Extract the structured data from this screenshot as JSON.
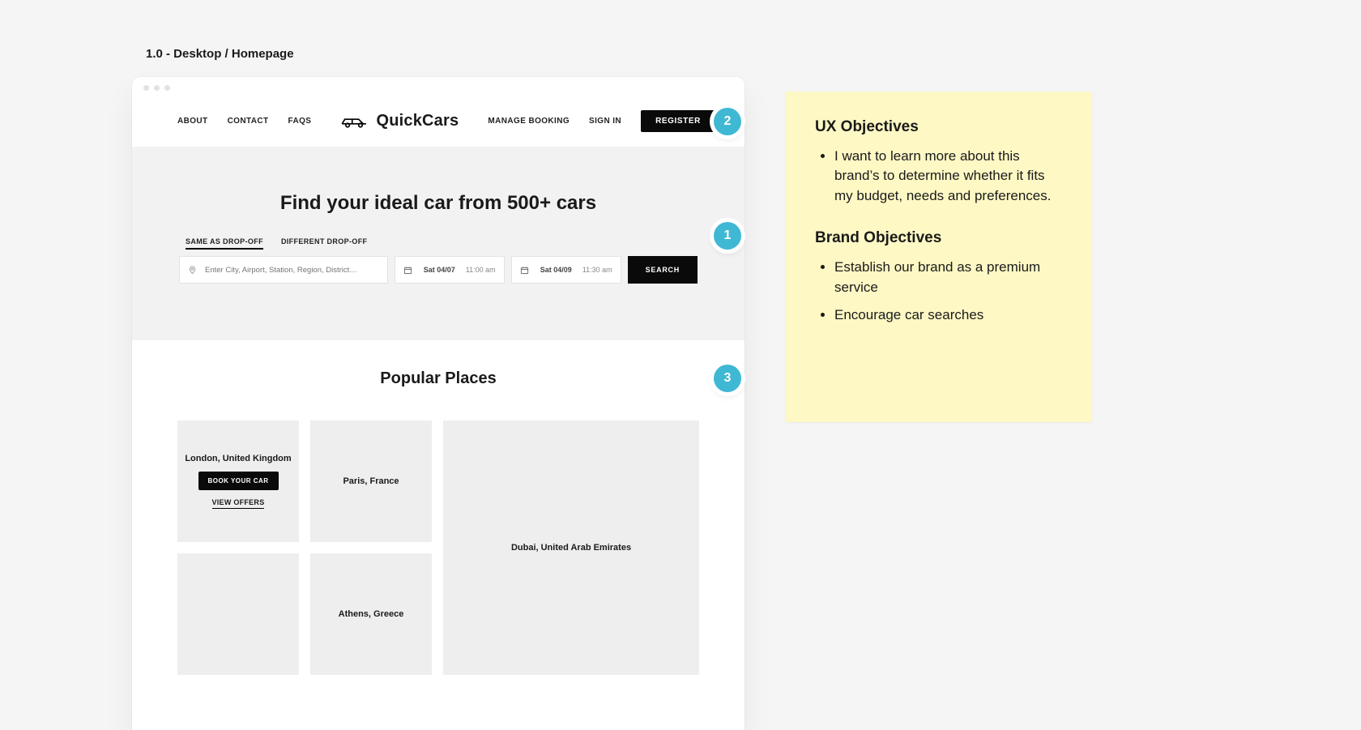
{
  "page_label": "1.0 - Desktop / Homepage",
  "header": {
    "brand": "QuickCars",
    "nav_left": [
      "ABOUT",
      "CONTACT",
      "FAQS"
    ],
    "manage": "MANAGE BOOKING",
    "signin": "SIGN IN",
    "register": "REGISTER"
  },
  "hero": {
    "title": "Find your ideal car from 500+ cars",
    "tabs": [
      "SAME AS DROP-OFF",
      "DIFFERENT DROP-OFF"
    ],
    "location_placeholder": "Enter City, Airport, Station, Region, District…",
    "pickup": {
      "date": "Sat 04/07",
      "time": "11:00 am"
    },
    "dropoff": {
      "date": "Sat 04/09",
      "time": "11:30 am"
    },
    "search": "SEARCH"
  },
  "popular": {
    "title": "Popular Places",
    "book_cta": "BOOK YOUR CAR",
    "offers_cta": "VIEW OFFERS",
    "places": {
      "london": "London, United Kingdom",
      "paris": "Paris, France",
      "athens": "Athens, Greece",
      "dubai": "Dubai, United Arab Emirates"
    }
  },
  "pins": {
    "p1": "1",
    "p2": "2",
    "p3": "3"
  },
  "note": {
    "h1": "UX Objectives",
    "ux1": "I want to learn more about this brand’s   to determine whether it fits my budget, needs and preferences.",
    "h2": "Brand Objectives",
    "b1": "Establish our brand as a premium service",
    "b2": "Encourage car searches"
  }
}
